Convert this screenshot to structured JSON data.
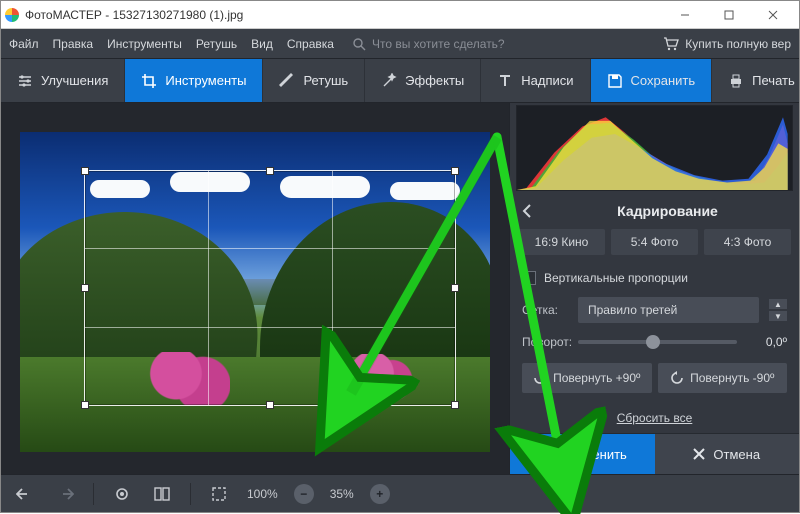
{
  "window": {
    "title": "ФотоМАСТЕР - 15327130271980 (1).jpg"
  },
  "menu": {
    "items": [
      "Файл",
      "Правка",
      "Инструменты",
      "Ретушь",
      "Вид",
      "Справка"
    ],
    "search_placeholder": "Что вы хотите сделать?",
    "buy": "Купить полную вер"
  },
  "toolbar": {
    "improve": "Улучшения",
    "tools": "Инструменты",
    "retouch": "Ретушь",
    "effects": "Эффекты",
    "captions": "Надписи",
    "save": "Сохранить",
    "print": "Печать"
  },
  "statusbar": {
    "zoom_fit": "100%",
    "zoom_cur": "35%"
  },
  "panel": {
    "title": "Кадрирование",
    "ratios": [
      "16:9 Кино",
      "5:4 Фото",
      "4:3 Фото"
    ],
    "vertical": "Вертикальные пропорции",
    "grid_label": "Сетка:",
    "grid_value": "Правило третей",
    "rotate_label": "Поворот:",
    "rotate_value": "0,0º",
    "rot_plus": "Повернуть +90º",
    "rot_minus": "Повернуть -90º",
    "reset": "Сбросить все",
    "apply": "Применить",
    "cancel": "Отмена"
  }
}
